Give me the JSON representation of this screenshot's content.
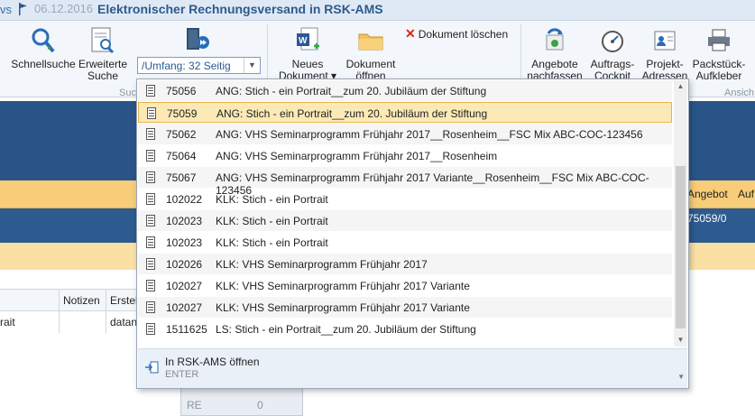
{
  "titlebar": {
    "left_text": "vs",
    "date": "06.12.2016",
    "title": "Elektronischer Rechnungsversand in RSK-AMS"
  },
  "ribbon": {
    "schnellsuche": "Schnellsuche",
    "erweiterte_line1": "Erweiterte",
    "erweiterte_line2": "Suche",
    "group_such": "Such",
    "combo_value": "/Umfang: 32 Seitig",
    "neues_line1": "Neues",
    "neues_line2": "Dokument ▾",
    "oeffnen_line1": "Dokument",
    "oeffnen_line2": "öffnen",
    "delete_label": "Dokument löschen",
    "angebote_line1": "Angebote",
    "angebote_line2": "nachfassen",
    "auftrags_line1": "Auftrags-",
    "auftrags_line2": "Cockpit",
    "projekt_line1": "Projekt-",
    "projekt_line2": "Adressen",
    "packstueck_line1": "Packstück-",
    "packstueck_line2": "Aufkleber",
    "group_ansich": "Ansich"
  },
  "background": {
    "col_angebot": "Angebot",
    "col_auf": "Auf",
    "angebot_value": "75059/0",
    "col_notizen": "Notizen",
    "col_erstel": "Erstel",
    "row_rait": "rait",
    "row_datan": "datan",
    "panel_re": "RE",
    "panel_zero": "0"
  },
  "dropdown": {
    "items": [
      {
        "num": "75056",
        "text": "ANG: Stich - ein Portrait__zum 20. Jubiläum der Stiftung"
      },
      {
        "num": "75059",
        "text": "ANG: Stich - ein Portrait__zum 20. Jubiläum der Stiftung"
      },
      {
        "num": "75062",
        "text": "ANG: VHS Seminarprogramm Frühjahr 2017__Rosenheim__FSC Mix ABC-COC-123456"
      },
      {
        "num": "75064",
        "text": "ANG: VHS Seminarprogramm Frühjahr 2017__Rosenheim"
      },
      {
        "num": "75067",
        "text": "ANG: VHS Seminarprogramm Frühjahr 2017 Variante__Rosenheim__FSC Mix ABC-COC-123456"
      },
      {
        "num": "102022",
        "text": "KLK: Stich - ein Portrait"
      },
      {
        "num": "102023",
        "text": "KLK: Stich - ein Portrait"
      },
      {
        "num": "102023",
        "text": "KLK: Stich - ein Portrait"
      },
      {
        "num": "102026",
        "text": "KLK: VHS Seminarprogramm Frühjahr 2017"
      },
      {
        "num": "102027",
        "text": "KLK: VHS Seminarprogramm Frühjahr 2017 Variante"
      },
      {
        "num": "102027",
        "text": "KLK: VHS Seminarprogramm Frühjahr 2017 Variante"
      },
      {
        "num": "1511625",
        "text": "LS: Stich - ein Portrait__zum 20. Jubiläum der Stiftung"
      }
    ],
    "open_label": "In RSK-AMS öffnen",
    "open_shortcut": "ENTER"
  }
}
